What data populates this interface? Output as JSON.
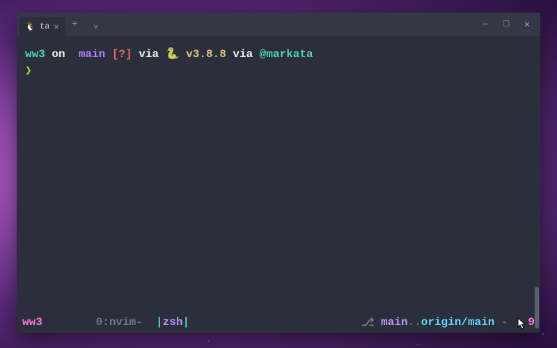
{
  "tab": {
    "icon": "🐧",
    "title": "ta",
    "close": "✕"
  },
  "titlebar": {
    "new_tab": "+",
    "dropdown": "⌄",
    "minimize": "—",
    "maximize": "□",
    "close": "✕"
  },
  "prompt": {
    "dir": "ww3",
    "on": " on ",
    "branch_icon": "",
    "branch": " main ",
    "status": "[?]",
    "via1": " via ",
    "python_icon": "🐍",
    "python_version": " v3.8.8 ",
    "via2": "via ",
    "service": "@markata",
    "cursor": "❯"
  },
  "statusbar": {
    "session": "ww3",
    "win0": "0:nvim-",
    "sep1": "  |",
    "shell": "zsh",
    "sep2": "|",
    "git_icon": "⎇",
    "local_branch": " main",
    "dots": "..",
    "remote_branch": "origin/main",
    "dash": " - ",
    "dot": ".",
    "count": " 9"
  }
}
